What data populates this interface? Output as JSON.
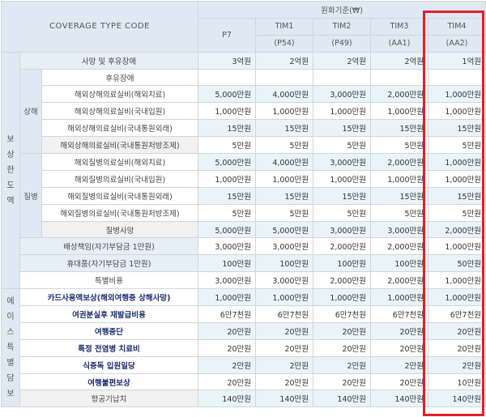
{
  "header": {
    "coverage_code_label": "COVERAGE TYPE CODE",
    "currency_label": "원화기준(₩)",
    "plans": [
      {
        "name": "P7",
        "code": ""
      },
      {
        "name": "TIM1",
        "code": "(P54)"
      },
      {
        "name": "TIM2",
        "code": "(P49)"
      },
      {
        "name": "TIM3",
        "code": "(AA1)"
      },
      {
        "name": "TIM4",
        "code": "(AA2)"
      }
    ]
  },
  "groups": {
    "coverage_limit": "보상한도액",
    "ace_special": "에이스특별담보",
    "injury": "상해",
    "disease": "질병"
  },
  "rows": [
    {
      "label": "사망 및 후유장애",
      "values": [
        "3억원",
        "2억원",
        "2억원",
        "2억원",
        "1억원"
      ]
    },
    {
      "label": "후유장애",
      "values": [
        "",
        "",
        "",
        "",
        ""
      ]
    },
    {
      "label": "해외상해의료실비(해외치료)",
      "values": [
        "5,000만원",
        "4,000만원",
        "3,000만원",
        "2,000만원",
        "1,000만원"
      ]
    },
    {
      "label": "해외상해의료실비(국내입원)",
      "values": [
        "1,000만원",
        "1,000만원",
        "1,000만원",
        "1,000만원",
        "1,000만원"
      ]
    },
    {
      "label": "해외상해의료실비(국내통원외래)",
      "values": [
        "15만원",
        "15만원",
        "15만원",
        "15만원",
        "15만원"
      ]
    },
    {
      "label": "해외상해의료실비(국내통원처방조제)",
      "values": [
        "5만원",
        "5만원",
        "5만원",
        "5만원",
        "5만원"
      ]
    },
    {
      "label": "해외질병의료실비(해외치료)",
      "values": [
        "5,000만원",
        "4,000만원",
        "3,000만원",
        "2,000만원",
        "1,000만원"
      ]
    },
    {
      "label": "해외질병의료실비(국내입원)",
      "values": [
        "1,000만원",
        "1,000만원",
        "1,000만원",
        "1,000만원",
        "1,000만원"
      ]
    },
    {
      "label": "해외질병의료실비(국내통원외래)",
      "values": [
        "15만원",
        "15만원",
        "15만원",
        "15만원",
        "15만원"
      ]
    },
    {
      "label": "해외질병의료실비(국내통원처방조제)",
      "values": [
        "5만원",
        "5만원",
        "5만원",
        "5만원",
        "5만원"
      ]
    },
    {
      "label": "질병사망",
      "values": [
        "5,000만원",
        "5,000만원",
        "3,000만원",
        "3,000만원",
        "2,000만원"
      ]
    },
    {
      "label": "배상책임(자기부담금 1만원)",
      "values": [
        "3,000만원",
        "3,000만원",
        "2,000만원",
        "2,000만원",
        "1,000만원"
      ]
    },
    {
      "label": "휴대품(자기부담금 1만원)",
      "values": [
        "100만원",
        "100만원",
        "100만원",
        "100만원",
        "50만원"
      ]
    },
    {
      "label": "특별비용",
      "values": [
        "3,000만원",
        "3,000만원",
        "2,000만원",
        "2,000만원",
        "1,000만원"
      ]
    },
    {
      "label": "카드사용액보상(해외여행중 상해사망)",
      "values": [
        "1,000만원",
        "1,000만원",
        "1,000만원",
        "1,000만원",
        "1,000만원"
      ]
    },
    {
      "label": "여권분실후 재발급비용",
      "values": [
        "6만7천원",
        "6만7천원",
        "6만7천원",
        "6만7천원",
        "6만7천원"
      ]
    },
    {
      "label": "여행중단",
      "values": [
        "20만원",
        "20만원",
        "20만원",
        "20만원",
        "20만원"
      ]
    },
    {
      "label": "특정 전염병 치료비",
      "values": [
        "20만원",
        "20만원",
        "20만원",
        "20만원",
        "20만원"
      ]
    },
    {
      "label": "식중독 입원일당",
      "values": [
        "2만원",
        "2만원",
        "2만원",
        "2만원",
        "2만원"
      ]
    },
    {
      "label": "여행불편보상",
      "values": [
        "20만원",
        "20만원",
        "20만원",
        "20만원",
        "10만원"
      ]
    },
    {
      "label": "항공기납치",
      "values": [
        "140만원",
        "140만원",
        "140만원",
        "140만원",
        "140만원"
      ]
    }
  ]
}
